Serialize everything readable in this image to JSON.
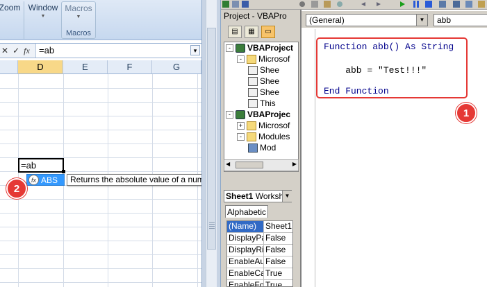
{
  "excel": {
    "ribbon": {
      "zoom_label": "Zoom",
      "window_label": "Window",
      "macros_label": "Macros",
      "macros_group_label": "Macros"
    },
    "formula_bar": {
      "cancel_glyph": "✕",
      "enter_glyph": "✓",
      "fx_glyph": "fx",
      "content": "=ab",
      "expand_glyph": "▾"
    },
    "columns": [
      "D",
      "E",
      "F",
      "G"
    ],
    "selected_column": "D",
    "active_cell_text": "=ab",
    "autocomplete": {
      "item_label": "ABS",
      "icon": "function-icon",
      "tooltip": "Returns the absolute value of a number, a number without its sign"
    },
    "callout_2": "2"
  },
  "vbe": {
    "project_title": "Project - VBAPro",
    "tree": [
      {
        "label": "VBAProject",
        "icon": "project-icon",
        "expander": "-",
        "level": 0
      },
      {
        "label": "Microsof",
        "icon": "folder-icon",
        "expander": "-",
        "level": 1
      },
      {
        "label": "Shee",
        "icon": "sheet-icon",
        "expander": "",
        "level": 2
      },
      {
        "label": "Shee",
        "icon": "sheet-icon",
        "expander": "",
        "level": 2
      },
      {
        "label": "Shee",
        "icon": "sheet-icon",
        "expander": "",
        "level": 2
      },
      {
        "label": "This",
        "icon": "workbook-icon",
        "expander": "",
        "level": 2
      },
      {
        "label": "VBAProjec",
        "icon": "project-icon",
        "expander": "-",
        "level": 0
      },
      {
        "label": "Microsof",
        "icon": "folder-icon",
        "expander": "+",
        "level": 1
      },
      {
        "label": "Modules",
        "icon": "folder-icon",
        "expander": "-",
        "level": 1
      },
      {
        "label": "Mod",
        "icon": "module-icon",
        "expander": "",
        "level": 2
      }
    ],
    "properties": {
      "object_name": "Sheet1",
      "object_type": "Worksh",
      "tab_label": "Alphabetic",
      "rows": [
        {
          "name": "(Name)",
          "value": "Sheet1",
          "selected": true
        },
        {
          "name": "DisplayPa",
          "value": "False",
          "selected": false
        },
        {
          "name": "DisplayRig",
          "value": "False",
          "selected": false
        },
        {
          "name": "EnableAut",
          "value": "False",
          "selected": false
        },
        {
          "name": "EnableCal",
          "value": "True",
          "selected": false
        },
        {
          "name": "EnableFor",
          "value": "True",
          "selected": false
        }
      ]
    },
    "code": {
      "object_combo": "(General)",
      "proc_combo": "abb",
      "line1": "Function abb() As String",
      "line2": "    abb = \"Test!!!\"",
      "line3": "End Function"
    },
    "callout_1": "1"
  },
  "colors": {
    "callout_red": "#e53935",
    "autocomplete_blue": "#3399ff",
    "keyword_blue": "#00008b"
  }
}
